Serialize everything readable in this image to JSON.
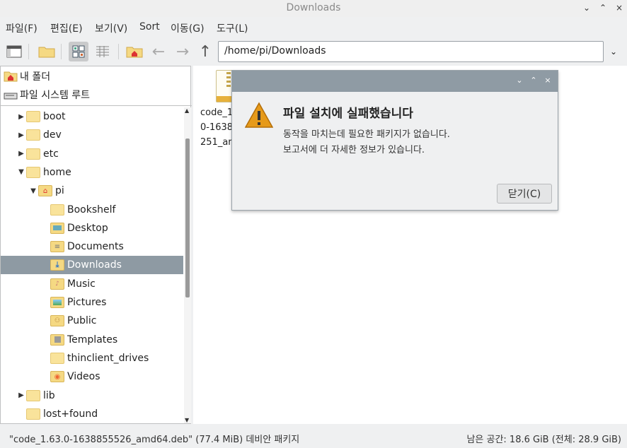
{
  "window": {
    "title": "Downloads",
    "controls": [
      "⌄",
      "⌃",
      "×"
    ]
  },
  "menu": [
    "파일(F)",
    "편집(E)",
    "보기(V)",
    "Sort",
    "이동(G)",
    "도구(L)"
  ],
  "toolbar": {
    "path": "/home/pi/Downloads"
  },
  "places": [
    "내 폴더",
    "파일 시스템 루트"
  ],
  "tree": [
    {
      "label": "boot",
      "depth": 0,
      "expander": "▶"
    },
    {
      "label": "dev",
      "depth": 0,
      "expander": "▶"
    },
    {
      "label": "etc",
      "depth": 0,
      "expander": "▶"
    },
    {
      "label": "home",
      "depth": 0,
      "expander": "▼"
    },
    {
      "label": "pi",
      "depth": 1,
      "expander": "▼",
      "icon": "home-folder-icon"
    },
    {
      "label": "Bookshelf",
      "depth": 2
    },
    {
      "label": "Desktop",
      "depth": 2,
      "icon": "desktop-folder-icon"
    },
    {
      "label": "Documents",
      "depth": 2,
      "icon": "documents-folder-icon"
    },
    {
      "label": "Downloads",
      "depth": 2,
      "icon": "downloads-folder-icon",
      "selected": true
    },
    {
      "label": "Music",
      "depth": 2,
      "icon": "music-folder-icon"
    },
    {
      "label": "Pictures",
      "depth": 2,
      "icon": "pictures-folder-icon"
    },
    {
      "label": "Public",
      "depth": 2,
      "icon": "public-folder-icon"
    },
    {
      "label": "Templates",
      "depth": 2,
      "icon": "templates-folder-icon"
    },
    {
      "label": "thinclient_drives",
      "depth": 2
    },
    {
      "label": "Videos",
      "depth": 2,
      "icon": "videos-folder-icon"
    },
    {
      "label": "lib",
      "depth": 0,
      "expander": "▶"
    },
    {
      "label": "lost+found",
      "depth": 0
    }
  ],
  "files": [
    {
      "name_lines": [
        "code_1",
        "0-1638",
        "251_ar"
      ]
    }
  ],
  "dialog": {
    "controls": [
      "⌄",
      "⌃",
      "×"
    ],
    "heading": "파일 설치에 실패했습니다",
    "message_line1": "동작을 마치는데 필요한 패키지가 없습니다.",
    "message_line2": "보고서에 더 자세한 정보가 있습니다.",
    "close_label": "닫기(C)"
  },
  "status": {
    "left": "\"code_1.63.0-1638855526_amd64.deb\" (77.4 MiB) 데비안 패키지",
    "right": "남은 공간: 18.6 GiB (전체: 28.9 GiB)"
  },
  "colors": {
    "selection": "#8e9aa3",
    "folder": "#f5d983",
    "dialog_titlebar": "#8f9ba4",
    "warning": "#e69a1a"
  }
}
